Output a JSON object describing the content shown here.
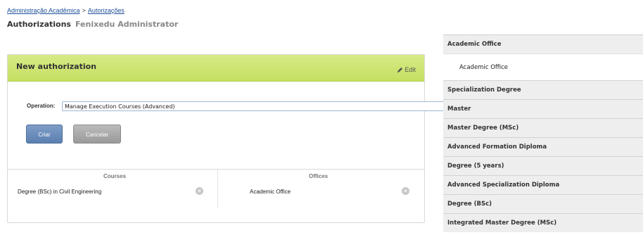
{
  "breadcrumb": {
    "items": [
      "Administração Acadêmica",
      "Autorizações"
    ],
    "separator": ">"
  },
  "heading": {
    "title": "Authorizations",
    "subtitle": "Fenixedu Administrator"
  },
  "panel": {
    "title": "New authorization",
    "edit_label": "Edit",
    "operation_label": "Operation:",
    "operation_value": "Manage Execution Courses (Advanced)",
    "create_button": "Criar",
    "cancel_button": "Cancelar",
    "courses_header": "Courses",
    "offices_header": "Offices",
    "course_item": "Degree (BSc) in Civil Engineering",
    "office_item": "Academic Office"
  },
  "sidebar": {
    "sections": [
      {
        "label": "Academic Office",
        "expanded": true,
        "items": [
          "Academic Office"
        ]
      },
      {
        "label": "Specialization Degree"
      },
      {
        "label": "Master"
      },
      {
        "label": "Master Degree (MSc)"
      },
      {
        "label": "Advanced Formation Diploma"
      },
      {
        "label": "Degree (5 years)"
      },
      {
        "label": "Advanced Specialization Diploma"
      },
      {
        "label": "Degree (BSc)"
      },
      {
        "label": "Integrated Master Degree (MSc)"
      }
    ]
  },
  "colors": {
    "panel_header": "#c9e16b",
    "primary_button": "#6b8cbb",
    "cancel_button": "#a8a8a8",
    "link": "#1d4f9a"
  },
  "icons": {
    "edit": "pencil-icon",
    "remove": "remove-circle-icon",
    "select_arrow": "select-arrows-icon"
  }
}
